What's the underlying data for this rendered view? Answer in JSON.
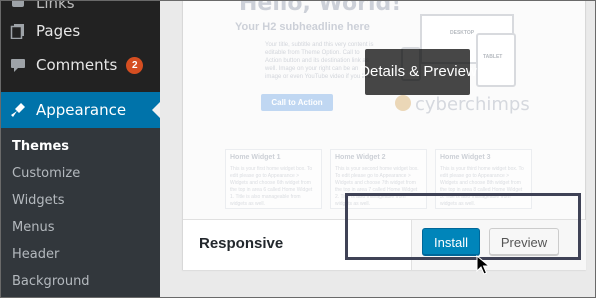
{
  "sidebar": {
    "partial_item": "Links",
    "items": [
      {
        "label": "Pages",
        "icon": "pages-icon"
      },
      {
        "label": "Comments",
        "icon": "comments-icon",
        "badge": "2"
      },
      {
        "label": "Appearance",
        "icon": "appearance-icon"
      }
    ],
    "submenu": [
      "Themes",
      "Customize",
      "Widgets",
      "Menus",
      "Header",
      "Background"
    ],
    "current_submenu": "Themes"
  },
  "theme": {
    "name": "Responsive",
    "preview": {
      "headline": "Hello, World!",
      "subheadline": "Your H2 subheadline here",
      "body": "Your title, subtitle and this very content is editable from Theme Option. Call to Action button and its destination link as well. Image on your right can be an image or even YouTube video if you like.",
      "cta": "Call to Action",
      "device_desktop": "DESKTOP",
      "device_tablet": "TABLET",
      "logo": "cyberchimps",
      "widgets": [
        {
          "title": "Home Widget 1",
          "text": "This is your first home widget box. To edit please go to Appearance > Widgets and choose 6th widget from the top in area 6 called Home Widget 1. Title is also manageable from widgets as well."
        },
        {
          "title": "Home Widget 2",
          "text": "This is your second home widget box. To edit please go to Appearance > Widgets and choose 7th widget from the top in area 7 called Home Widget 2. Title is also manageable from widgets as well."
        },
        {
          "title": "Home Widget 3",
          "text": "This is your third home widget box. To edit please go to Appearance > Widgets and choose 8th widget from the top in area 8 called Home Widget 3. Title is also manageable from widgets as well."
        }
      ]
    },
    "details_label": "Details & Preview",
    "install_label": "Install",
    "preview_label": "Preview"
  },
  "colors": {
    "sidebar_bg": "#222222",
    "submenu_bg": "#32373c",
    "accent": "#0073aa",
    "install_button": "#0085ba",
    "badge": "#d54e21"
  }
}
